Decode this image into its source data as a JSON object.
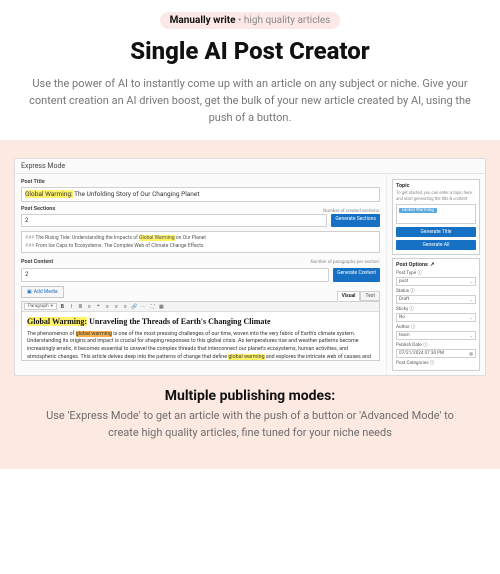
{
  "header": {
    "pill_bold": "Manually write",
    "pill_light": " • high quality articles",
    "title": "Single AI Post Creator",
    "lead": "Use the power of AI to instantly come up with an article on any subject or niche. Give your content creation an AI driven boost, get the bulk of your new article created by AI, using the push of a button."
  },
  "shot": {
    "window_title": "Express Mode",
    "main": {
      "post_title_label": "Post Title",
      "post_title_hl": "Global Warming:",
      "post_title_rest": " The Unfolding Story of Our Changing Planet",
      "post_sections_label": "Post Sections",
      "sections_counter": "Number of created sections:",
      "sections_value": "2",
      "generate_sections_btn": "Generate Sections",
      "section_items": [
        {
          "num": "###",
          "pre": " The Rising Tide: Understanding the Impacts of ",
          "hl": "Global Warming",
          "post": " on Our Planet"
        },
        {
          "num": "###",
          "pre": " From Ice Caps to Ecosystems: The Complex Web of Climate Change Effects",
          "hl": "",
          "post": ""
        }
      ],
      "post_content_label": "Post Content",
      "paragraphs_counter": "Number of paragraphs per section:",
      "paragraphs_value": "2",
      "generate_content_btn": "Generate Content",
      "add_media_btn": "Add Media",
      "tabs": {
        "visual": "Visual",
        "text": "Text"
      },
      "toolbar": {
        "paragraph": "Paragraph"
      },
      "doc": {
        "heading_hl": "Global Warming:",
        "heading_rest": " Unraveling the Threads of Earth's Changing Climate",
        "body_a": "The phenomenon of ",
        "body_hl1": "global warming",
        "body_b": " is one of the most pressing challenges of our time, woven into the very fabric of Earth's climate system. Understanding its origins and impact is crucial for shaping responses to this global crisis. As temperatures rise and weather patterns become increasingly erratic, it becomes essential to unravel the complex threads that interconnect our planet's ecosystems, human activities, and atmospheric changes. This article delves deep into the patterns of change that define ",
        "body_hl2": "global warming",
        "body_c": " and explores the intricate web of causes and consequences surrounding climate shifts."
      }
    },
    "side": {
      "topic_label": "Topic",
      "topic_desc": "To get started, you can enter a topic here and start generating the title & content",
      "topic_value": "Global Warming",
      "generate_title_btn": "Generate Title",
      "generate_all_btn": "Generate All",
      "options_label": "Post Options",
      "opts": {
        "post_type_label": "Post Type",
        "post_type_value": "post",
        "status_label": "Status",
        "status_value": "Draft",
        "sticky_label": "Sticky",
        "sticky_value": "No",
        "author_label": "Author",
        "author_value": "team",
        "publish_date_label": "Publish Date",
        "publish_date_value": "07/21/2024  07:30 PM",
        "categories_label": "Post Categories"
      }
    }
  },
  "caption": {
    "title": "Multiple publishing modes:",
    "text": "Use 'Express Mode' to get an article with the push of a button or 'Advanced Mode' to create high quality articles, fine tuned for your niche needs"
  }
}
